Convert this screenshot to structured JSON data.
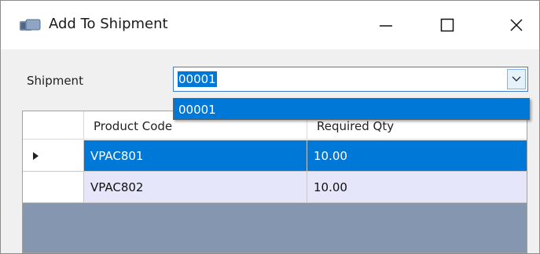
{
  "window": {
    "title": "Add To Shipment",
    "controls": [
      "minimize",
      "maximize",
      "close"
    ]
  },
  "shipment": {
    "label": "Shipment",
    "value": "00001",
    "options": [
      "00001"
    ]
  },
  "grid": {
    "columns": [
      "Product Code",
      "Required Qty"
    ],
    "rows": [
      {
        "product_code": "VPAC801",
        "required_qty": "10.00",
        "selected": true
      },
      {
        "product_code": "VPAC802",
        "required_qty": "10.00",
        "selected": false
      }
    ]
  },
  "colors": {
    "selection": "#0078d7",
    "alt_row": "#e6e6fa",
    "grid_background": "#8496b0"
  }
}
